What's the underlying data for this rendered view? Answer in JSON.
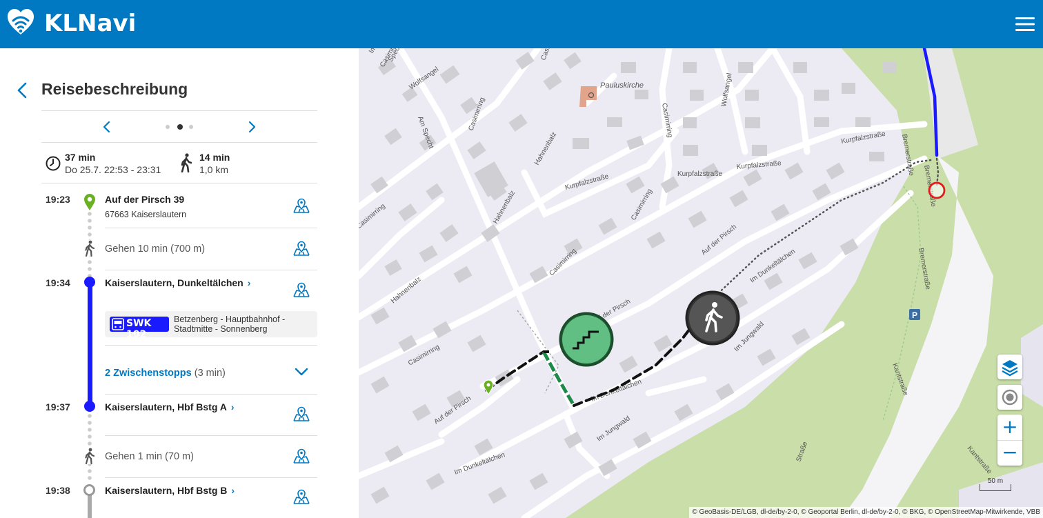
{
  "app": {
    "title": "KLNavi"
  },
  "panel": {
    "title": "Reisebeschreibung",
    "summary": {
      "duration": "37 min",
      "date_range": "Do 25.7. 22:53 - 23:31",
      "walk_duration": "14 min",
      "walk_distance": "1,0 km"
    },
    "pager": {
      "pages": 3,
      "active": 2
    },
    "timeline": {
      "start": {
        "time": "19:23",
        "name": "Auf der Pirsch 39",
        "sub": "67663 Kaiserslautern"
      },
      "walk1": "Gehen 10 min (700 m)",
      "stop1": {
        "time": "19:34",
        "name": "Kaiserslautern, Dunkeltälchen"
      },
      "bus": {
        "line": "SWK 102",
        "route": "Betzenberg - Hauptbahnhof - Stadtmitte - Sonnenberg"
      },
      "intermediate": {
        "link": "2 Zwischenstopps",
        "duration": "(3 min)"
      },
      "stop2": {
        "time": "19:37",
        "name": "Kaiserslautern, Hbf Bstg A"
      },
      "walk2": "Gehen 1 min (70 m)",
      "stop3": {
        "time": "19:38",
        "name": "Kaiserslautern, Hbf Bstg B"
      }
    }
  },
  "map": {
    "poi_church": "Pauluskirche",
    "streets": {
      "specht": "Specht",
      "wolfsangel": "Wolfsangel",
      "wolfsangel2": "Wolfsangel",
      "am_specht": "Am Specht",
      "casimirring": "Casimirring",
      "casimirring2": "Casimirring",
      "casimirring3": "Casimirring",
      "casimirring4": "Casimirring",
      "casimirring5": "Casimirring",
      "casimirring6": "Casimirring",
      "hahnenbalz": "Hahnenbalz",
      "hahnenbalz2": "Hahnenbalz",
      "hahnenbalz3": "Hahnenbalz",
      "kurpfalz1": "Kurpfalzstraße",
      "kurpfalz2": "Kurpfalzstraße",
      "kurpfalz3": "Kurpfalzstraße",
      "kurpfalz4": "Kurpfalzstraße",
      "pirsch1": "Auf der Pirsch",
      "pirsch2": "Auf der Pirsch",
      "pirsch3": "Auf der Pirsch",
      "jungwald1": "Im Jungwald",
      "jungwald2": "Im Jungwald",
      "jungwald3": "Im Jungwald",
      "dunkel1": "Im Dunkeltälchen",
      "dunkel2": "Im Dunkeltälchen",
      "bremer1": "Bremerstraße",
      "bremer2": "Bremerstraße",
      "bremer3": "Bremerstraße",
      "kant1": "Kantstraße",
      "kant2": "Kantstraße",
      "strasse": "Straße"
    },
    "parking": "P",
    "scale": "50 m",
    "attribution": "© GeoBasis-DE/LGB, dl-de/by-2-0, © Geoportal Berlin, dl-de/by-2-0, © BKG, © OpenStreetMap-Mitwirkende, VBB",
    "controls": {
      "zoom_in": "+",
      "zoom_out": "−"
    }
  },
  "colors": {
    "brand": "#0079c2",
    "bus_line": "#1a1aff",
    "start_pin": "#6ab023",
    "stairs": "#1e8a4a",
    "walk_marker": "#333333",
    "forest": "#c5dca0"
  }
}
